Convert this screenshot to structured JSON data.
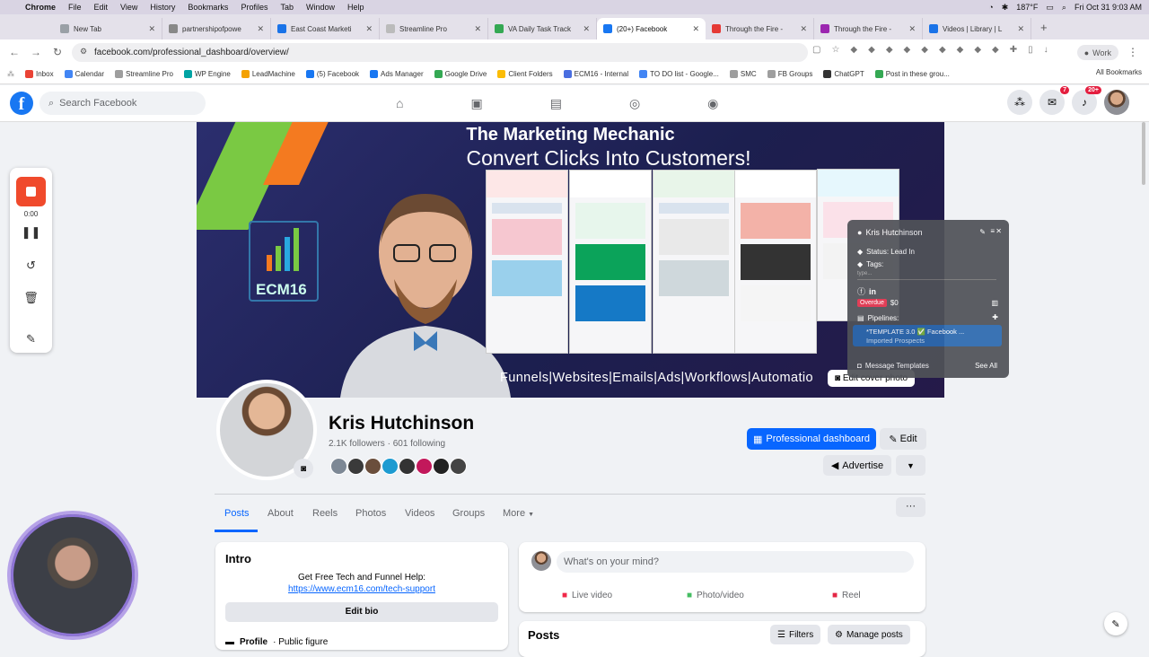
{
  "mac": {
    "app": "Chrome",
    "menu": [
      "File",
      "Edit",
      "View",
      "History",
      "Bookmarks",
      "Profiles",
      "Tab",
      "Window",
      "Help"
    ],
    "temp": "187°F",
    "clock": "Fri Oct 31  9:03 AM"
  },
  "tabs": [
    {
      "label": "New Tab",
      "color": "#9aa0a6"
    },
    {
      "label": "partnershipofpowe",
      "color": "#888888"
    },
    {
      "label": "East Coast Marketi",
      "color": "#1a73e8"
    },
    {
      "label": "Streamline Pro",
      "color": "#bbbbbb"
    },
    {
      "label": "VA Daily Task Track",
      "color": "#34a853"
    },
    {
      "label": "(20+) Facebook",
      "color": "#1877f2",
      "active": true
    },
    {
      "label": "Through the Fire -",
      "color": "#e53935"
    },
    {
      "label": "Through the Fire -",
      "color": "#9c27b0"
    },
    {
      "label": "Videos | Library | L",
      "color": "#1a73e8"
    }
  ],
  "address": {
    "url": "facebook.com/professional_dashboard/overview/",
    "profile": "Work"
  },
  "bookmarks": [
    {
      "label": "Inbox",
      "color": "#ea4335"
    },
    {
      "label": "Calendar",
      "color": "#4285f4"
    },
    {
      "label": "Streamline Pro",
      "color": "#9e9e9e"
    },
    {
      "label": "WP Engine",
      "color": "#00a3a3"
    },
    {
      "label": "LeadMachine",
      "color": "#f4a100"
    },
    {
      "label": "(5) Facebook",
      "color": "#1877f2"
    },
    {
      "label": "Ads Manager",
      "color": "#1877f2"
    },
    {
      "label": "Google Drive",
      "color": "#34a853"
    },
    {
      "label": "Client Folders",
      "color": "#fbbc05"
    },
    {
      "label": "ECM16 - Internal",
      "color": "#4a6ee0"
    },
    {
      "label": "TO DO list - Google...",
      "color": "#4285f4"
    },
    {
      "label": "SMC",
      "color": "#9e9e9e"
    },
    {
      "label": "FB Groups",
      "color": "#9e9e9e"
    },
    {
      "label": "ChatGPT",
      "color": "#333333"
    },
    {
      "label": "Post in these grou...",
      "color": "#34a853"
    }
  ],
  "bookmarks_all": "All Bookmarks",
  "fb": {
    "logo": "f",
    "search_placeholder": "Search Facebook",
    "messenger_badge": "7",
    "notif_badge": "20+"
  },
  "cover": {
    "title": "The Marketing Mechanic",
    "subtitle": "Convert Clicks Into Customers!",
    "logo_text": "ECM16",
    "footer": "Funnels|Websites|Emails|Ads|Workflows|Automatio",
    "edit_label": "Edit cover photo"
  },
  "crm": {
    "name": "Kris Hutchinson",
    "status": "Status: Lead In",
    "tags": "Tags:",
    "tags_placeholder": "type...",
    "overdue": "Overdue",
    "amount": "$0",
    "pipelines": "Pipelines:",
    "pipeline_line1": "*TEMPLATE 3.0 ✅ Facebook ...",
    "pipeline_line2": "Imported Prospects",
    "message_templates": "Message Templates",
    "see_all": "See All"
  },
  "profile": {
    "name": "Kris Hutchinson",
    "followers": "2.1K followers · 601 following",
    "friend_colors": [
      "#7d8895",
      "#3a3a3a",
      "#6a4e3c",
      "#1d9bd1",
      "#333333",
      "#c2185b",
      "#222222",
      "#444444"
    ],
    "dashboard_label": "Professional dashboard",
    "edit_label": "Edit",
    "advertise_label": "Advertise"
  },
  "profile_tabs": [
    "Posts",
    "About",
    "Reels",
    "Photos",
    "Videos",
    "Groups",
    "More"
  ],
  "intro": {
    "title": "Intro",
    "help": "Get Free Tech and Funnel Help:",
    "link": "https://www.ecm16.com/tech-support",
    "edit_bio": "Edit bio",
    "profile_label": "Profile",
    "profile_type": "· Public figure"
  },
  "composer": {
    "placeholder": "What's on your mind?",
    "live": "Live video",
    "photo": "Photo/video",
    "reel": "Reel"
  },
  "posts": {
    "title": "Posts",
    "filters": "Filters",
    "manage": "Manage posts"
  },
  "recorder": {
    "time": "0:00"
  }
}
